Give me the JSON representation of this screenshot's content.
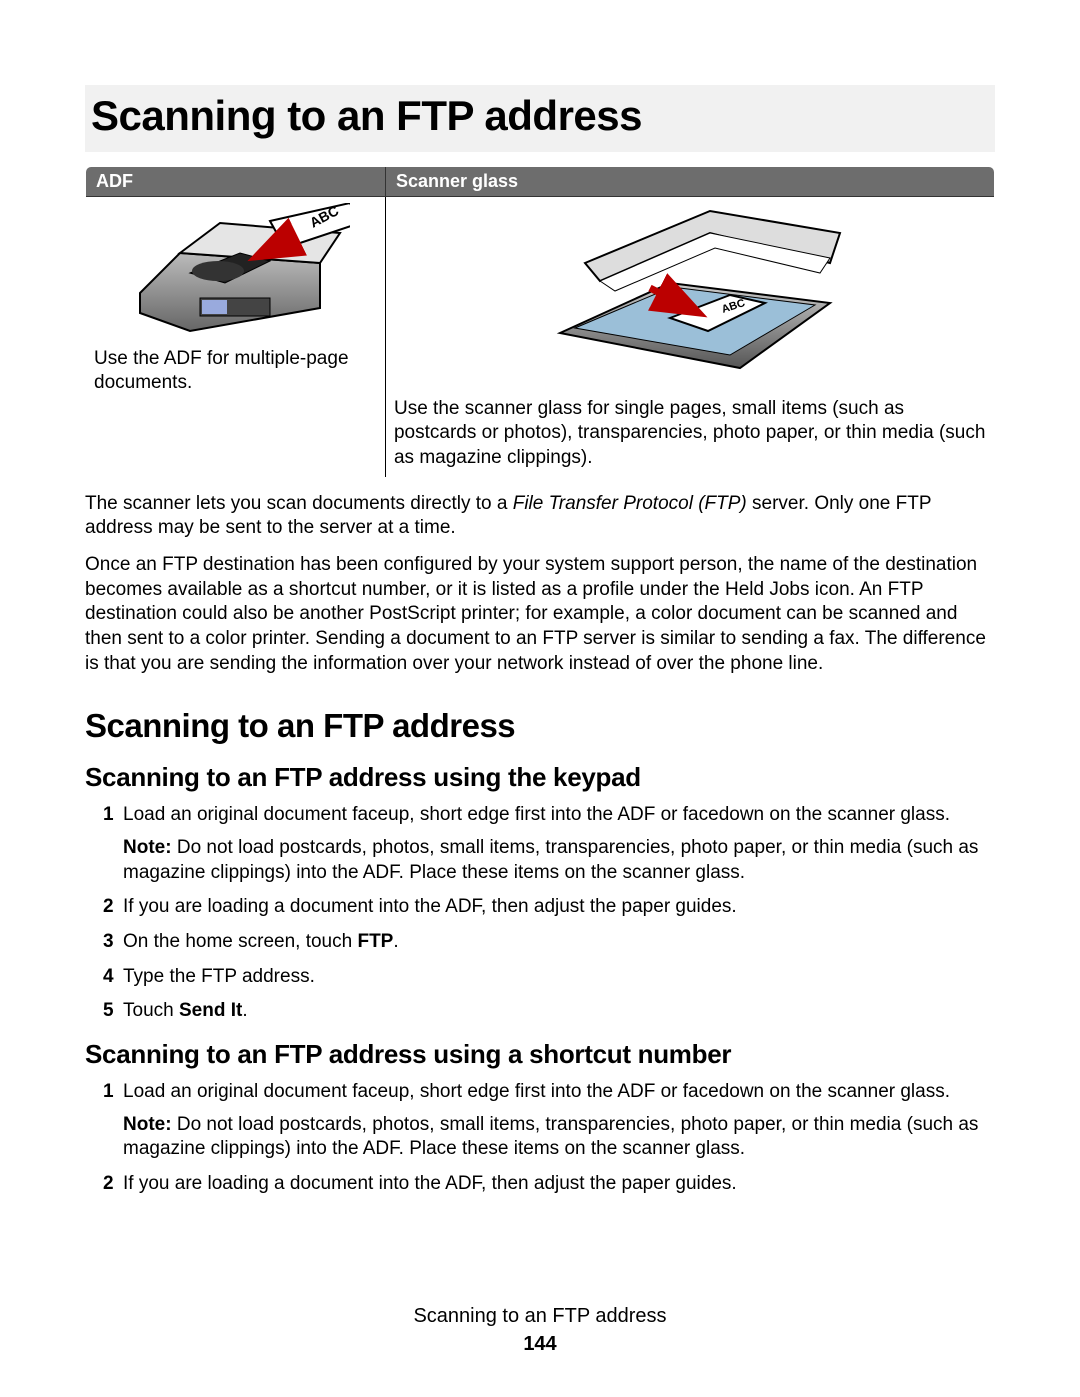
{
  "chapter_title": "Scanning to an FTP address",
  "table": {
    "headers": [
      "ADF",
      "Scanner glass"
    ],
    "adf_text": "Use the ADF for multiple-page documents.",
    "glass_text": "Use the scanner glass for single pages, small items (such as postcards or photos), transparencies, photo paper, or thin media (such as magazine clippings)."
  },
  "intro_para1a": "The scanner lets you scan documents directly to a ",
  "intro_para1_italic": "File Transfer Protocol (FTP)",
  "intro_para1b": " server. Only one FTP address may be sent to the server at a time.",
  "intro_para2": "Once an FTP destination has been configured by your system support person, the name of the destination becomes available as a shortcut number, or it is listed as a profile under the Held Jobs icon. An FTP destination could also be another PostScript printer; for example, a color document can be scanned and then sent to a color printer. Sending a document to an FTP server is similar to sending a fax. The difference is that you are sending the information over your network instead of over the phone line.",
  "section_title": "Scanning to an FTP address",
  "sub1_title": "Scanning to an FTP address using the keypad",
  "sub1_steps": {
    "s1": "Load an original document faceup, short edge first into the ADF or facedown on the scanner glass.",
    "s1_note_label": "Note:",
    "s1_note": " Do not load postcards, photos, small items, transparencies, photo paper, or thin media (such as magazine clippings) into the ADF. Place these items on the scanner glass.",
    "s2": "If you are loading a document into the ADF, then adjust the paper guides.",
    "s3a": "On the home screen, touch ",
    "s3b": "FTP",
    "s3c": ".",
    "s4": "Type the FTP address.",
    "s5a": "Touch ",
    "s5b": "Send It",
    "s5c": "."
  },
  "sub2_title": "Scanning to an FTP address using a shortcut number",
  "sub2_steps": {
    "s1": "Load an original document faceup, short edge first into the ADF or facedown on the scanner glass.",
    "s1_note_label": "Note:",
    "s1_note": " Do not load postcards, photos, small items, transparencies, photo paper, or thin media (such as magazine clippings) into the ADF. Place these items on the scanner glass.",
    "s2": "If you are loading a document into the ADF, then adjust the paper guides."
  },
  "footer_title": "Scanning to an FTP address",
  "page_number": "144"
}
